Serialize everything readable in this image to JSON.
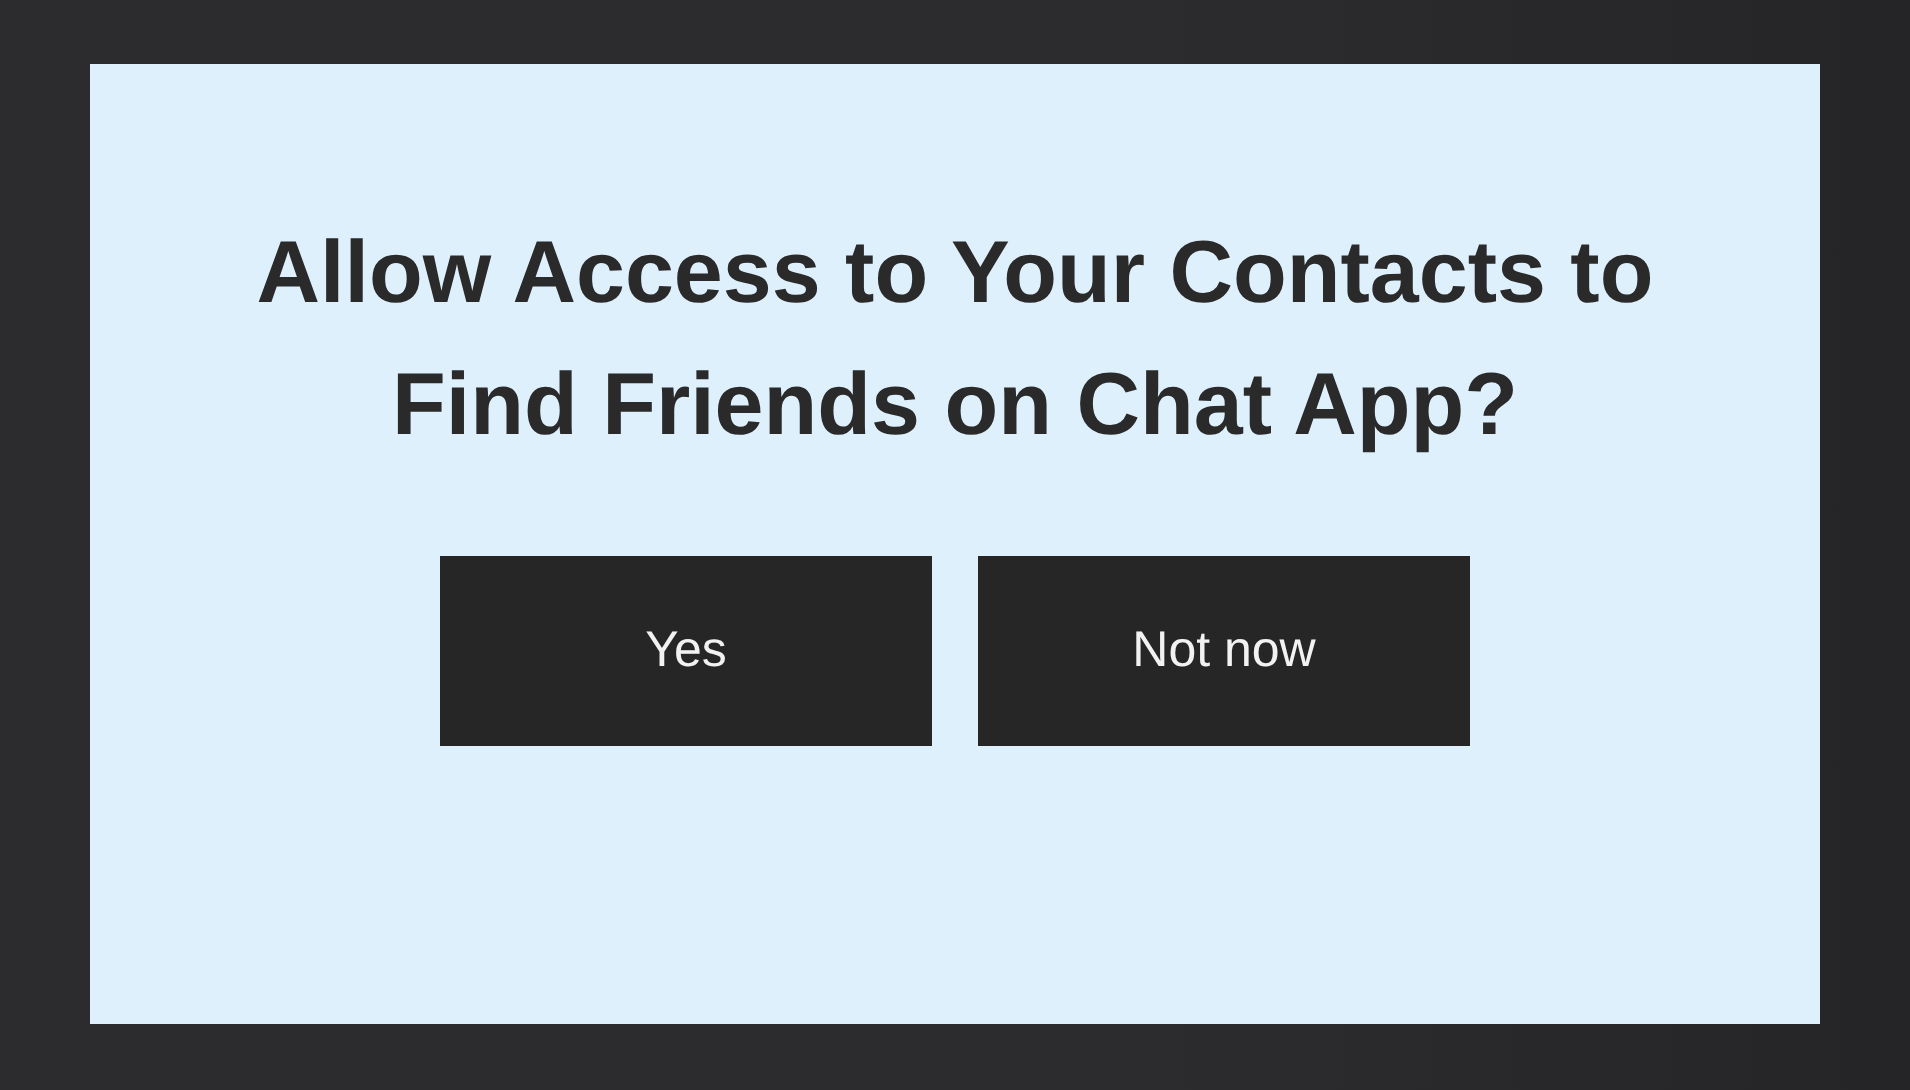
{
  "dialog": {
    "title": "Allow Access to Your Contacts to Find Friends on Chat App?",
    "buttons": [
      {
        "label": "Yes"
      },
      {
        "label": "Not now"
      }
    ]
  }
}
